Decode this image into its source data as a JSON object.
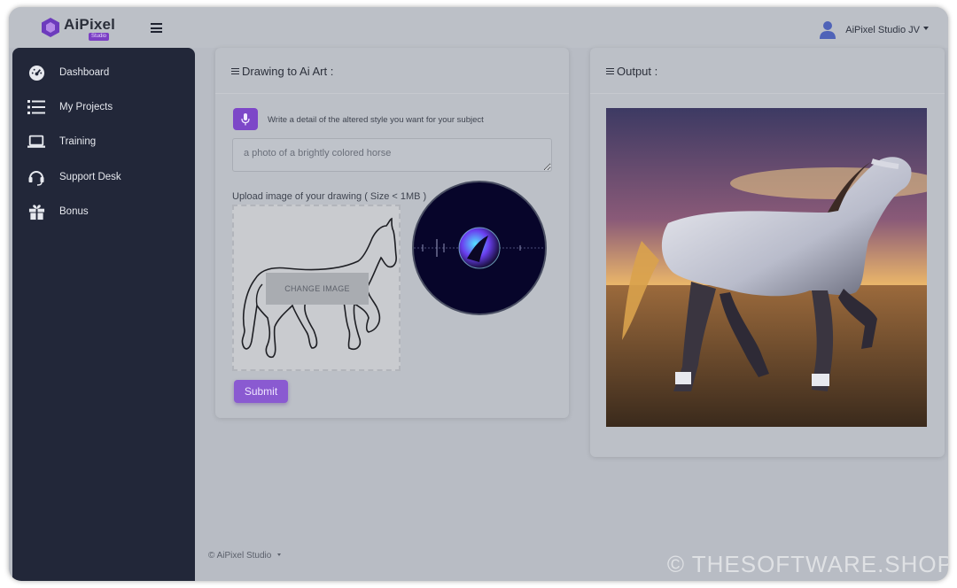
{
  "brand": {
    "name": "AiPixel",
    "badge": "Studio"
  },
  "user": {
    "name": "AiPixel Studio JV"
  },
  "sidebar": {
    "items": [
      {
        "label": "Dashboard",
        "icon": "dashboard-icon"
      },
      {
        "label": "My Projects",
        "icon": "list-icon"
      },
      {
        "label": "Training",
        "icon": "laptop-icon"
      },
      {
        "label": "Support Desk",
        "icon": "headset-icon"
      },
      {
        "label": "Bonus",
        "icon": "gift-icon"
      }
    ]
  },
  "drawing_card": {
    "title": "Drawing to Ai Art :",
    "prompt_label": "Write a detail of the altered style you want for your subject",
    "prompt_value": "a photo of a brightly colored horse",
    "upload_label": "Upload image of your drawing ( Size < 1MB )",
    "change_image": "CHANGE IMAGE",
    "submit": "Submit"
  },
  "output_card": {
    "title": "Output :"
  },
  "footer": {
    "copyright": "© AiPixel Studio"
  },
  "watermark": "© THESOFTWARE.SHOP",
  "colors": {
    "sidebar": "#222739",
    "accent": "#7d47c8",
    "background": "#b8bcc4"
  }
}
